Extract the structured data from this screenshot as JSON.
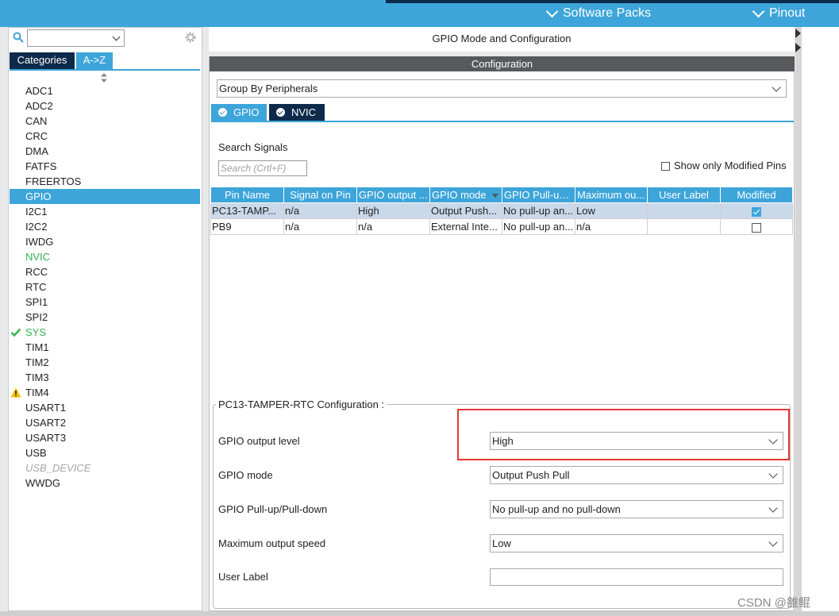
{
  "header": {
    "tabs": [
      {
        "label": "Software Packs"
      },
      {
        "label": "Pinout"
      }
    ]
  },
  "sidebar": {
    "search_value": "",
    "tabs": [
      "Categories",
      "A->Z"
    ],
    "items": [
      {
        "label": "ADC1",
        "state": "normal"
      },
      {
        "label": "ADC2",
        "state": "normal"
      },
      {
        "label": "CAN",
        "state": "normal"
      },
      {
        "label": "CRC",
        "state": "normal"
      },
      {
        "label": "DMA",
        "state": "normal"
      },
      {
        "label": "FATFS",
        "state": "normal"
      },
      {
        "label": "FREERTOS",
        "state": "normal"
      },
      {
        "label": "GPIO",
        "state": "selected"
      },
      {
        "label": "I2C1",
        "state": "normal"
      },
      {
        "label": "I2C2",
        "state": "normal"
      },
      {
        "label": "IWDG",
        "state": "normal"
      },
      {
        "label": "NVIC",
        "state": "green"
      },
      {
        "label": "RCC",
        "state": "normal"
      },
      {
        "label": "RTC",
        "state": "normal"
      },
      {
        "label": "SPI1",
        "state": "normal"
      },
      {
        "label": "SPI2",
        "state": "normal"
      },
      {
        "label": "SYS",
        "state": "checked"
      },
      {
        "label": "TIM1",
        "state": "normal"
      },
      {
        "label": "TIM2",
        "state": "normal"
      },
      {
        "label": "TIM3",
        "state": "normal"
      },
      {
        "label": "TIM4",
        "state": "warning"
      },
      {
        "label": "USART1",
        "state": "normal"
      },
      {
        "label": "USART2",
        "state": "normal"
      },
      {
        "label": "USART3",
        "state": "normal"
      },
      {
        "label": "USB",
        "state": "normal"
      },
      {
        "label": "USB_DEVICE",
        "state": "disabled"
      },
      {
        "label": "WWDG",
        "state": "normal"
      }
    ]
  },
  "main": {
    "title": "GPIO Mode and Configuration",
    "config_header": "Configuration",
    "group_by": "Group By Peripherals",
    "tabs": [
      {
        "label": "GPIO"
      },
      {
        "label": "NVIC"
      }
    ],
    "search_signals_label": "Search Signals",
    "search_placeholder": "Search (Crtl+F)",
    "show_modified_label": "Show only Modified Pins",
    "table": {
      "columns": [
        "Pin Name",
        "Signal on Pin",
        "GPIO output ...",
        "GPIO mode",
        "GPIO Pull-up...",
        "Maximum ou...",
        "User Label",
        "Modified"
      ],
      "rows": [
        {
          "cells": [
            "PC13-TAMP...",
            "n/a",
            "High",
            "Output Push...",
            "No pull-up an...",
            "Low",
            ""
          ],
          "modified": true,
          "selected": true
        },
        {
          "cells": [
            "PB9",
            "n/a",
            "n/a",
            "External Inte...",
            "No pull-up an...",
            "n/a",
            ""
          ],
          "modified": false,
          "selected": false
        }
      ]
    },
    "pin_config": {
      "title": "PC13-TAMPER-RTC Configuration :",
      "fields": [
        {
          "label": "GPIO output level",
          "value": "High"
        },
        {
          "label": "GPIO mode",
          "value": "Output Push Pull"
        },
        {
          "label": "GPIO Pull-up/Pull-down",
          "value": "No pull-up and no pull-down"
        },
        {
          "label": "Maximum output speed",
          "value": "Low"
        },
        {
          "label": "User Label",
          "value": ""
        }
      ]
    }
  },
  "watermark": "CSDN @雒鲲",
  "colors": {
    "accent": "#3da5d9",
    "dark": "#0d2a4a",
    "highlight": "#e53935",
    "ok": "#37b24d",
    "warning": "#f5c400"
  }
}
